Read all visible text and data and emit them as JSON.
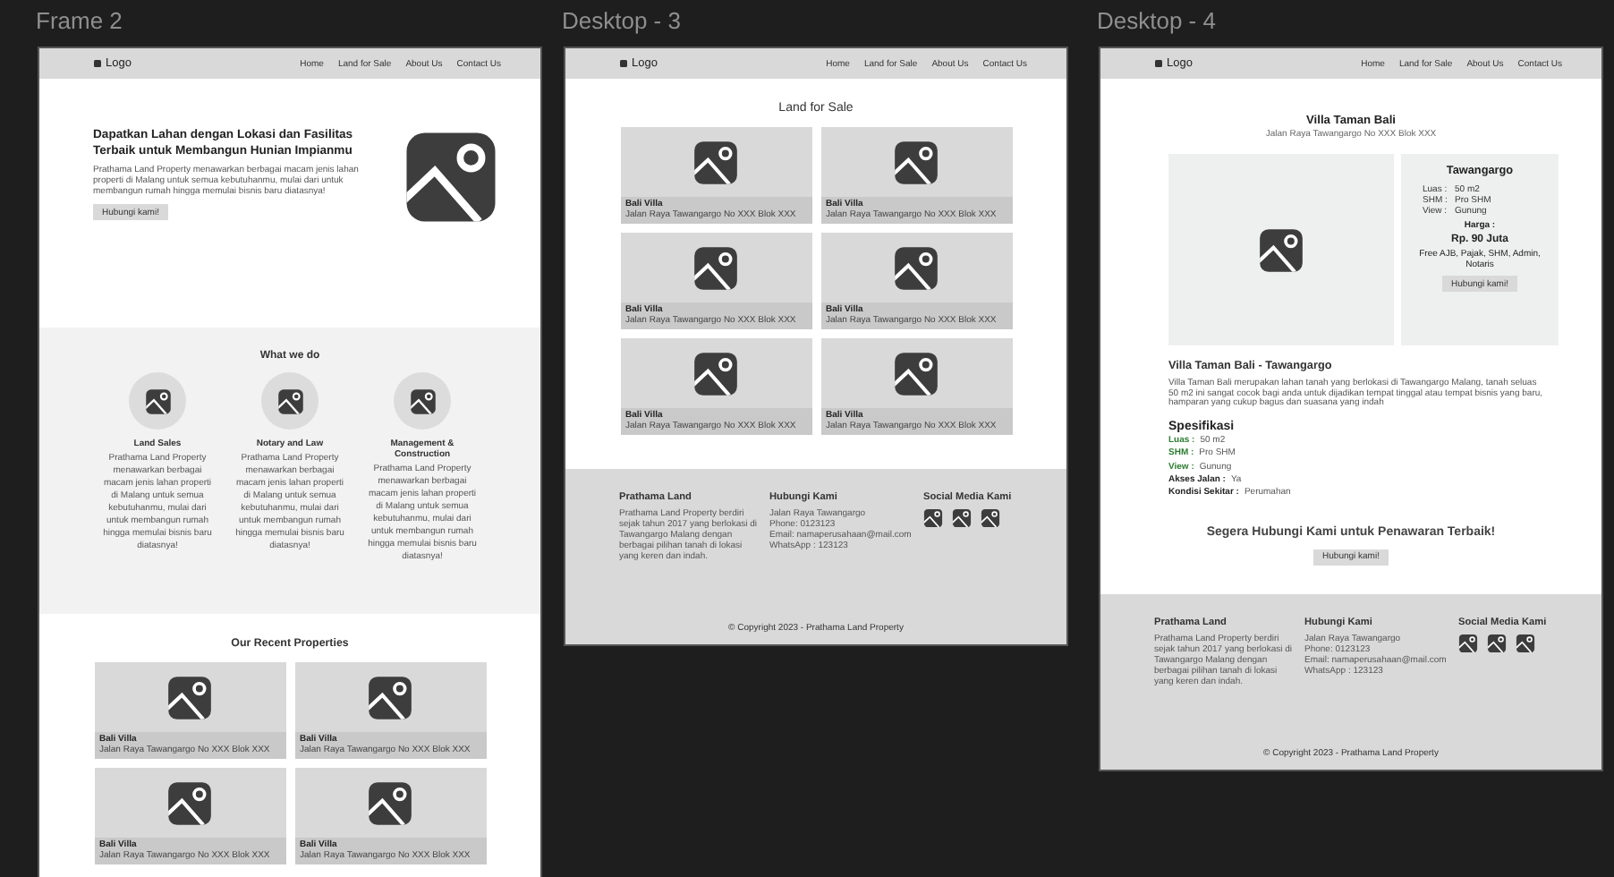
{
  "frames": [
    {
      "kind": "home",
      "title": "Frame 2",
      "nav": {
        "logo": "Logo",
        "links": [
          "Home",
          "Land for Sale",
          "About Us",
          "Contact Us"
        ]
      },
      "hero": {
        "heading": "Dapatkan Lahan dengan Lokasi dan Fasilitas Terbaik untuk Membangun Hunian Impianmu",
        "text": "Prathama Land Property menawarkan berbagai macam jenis lahan properti di Malang untuk semua kebutuhanmu, mulai dari untuk membangun rumah hingga memulai bisnis baru diatasnya!",
        "button": "Hubungi kami!"
      },
      "services": {
        "title": "What we do",
        "items": [
          {
            "title": "Land Sales",
            "text": "Prathama Land Property menawarkan berbagai macam jenis lahan properti di Malang untuk semua kebutuhanmu, mulai dari untuk membangun rumah hingga memulai bisnis baru diatasnya!"
          },
          {
            "title": "Notary and Law",
            "text": "Prathama Land Property menawarkan berbagai macam jenis lahan properti di Malang untuk semua kebutuhanmu, mulai dari untuk membangun rumah hingga memulai bisnis baru diatasnya!"
          },
          {
            "title": "Management & Construction",
            "text": "Prathama Land Property menawarkan berbagai macam jenis lahan properti di Malang untuk semua kebutuhanmu, mulai dari untuk membangun rumah hingga memulai bisnis baru diatasnya!"
          }
        ]
      },
      "recent": {
        "title": "Our Recent Properties",
        "cards": [
          {
            "name": "Bali Villa",
            "address": "Jalan Raya Tawangargo No XXX Blok XXX"
          },
          {
            "name": "Bali Villa",
            "address": "Jalan Raya Tawangargo No XXX Blok XXX"
          },
          {
            "name": "Bali Villa",
            "address": "Jalan Raya Tawangargo No XXX Blok XXX"
          },
          {
            "name": "Bali Villa",
            "address": "Jalan Raya Tawangargo No XXX Blok XXX"
          }
        ]
      }
    },
    {
      "kind": "listing",
      "title": "Desktop - 3",
      "nav": {
        "logo": "Logo",
        "links": [
          "Home",
          "Land for Sale",
          "About Us",
          "Contact Us"
        ]
      },
      "heading": "Land for Sale",
      "cards": [
        {
          "name": "Bali Villa",
          "address": "Jalan Raya Tawangargo No XXX Blok XXX"
        },
        {
          "name": "Bali Villa",
          "address": "Jalan Raya Tawangargo No XXX Blok XXX"
        },
        {
          "name": "Bali Villa",
          "address": "Jalan Raya Tawangargo No XXX Blok XXX"
        },
        {
          "name": "Bali Villa",
          "address": "Jalan Raya Tawangargo No XXX Blok XXX"
        },
        {
          "name": "Bali Villa",
          "address": "Jalan Raya Tawangargo No XXX Blok XXX"
        },
        {
          "name": "Bali Villa",
          "address": "Jalan Raya Tawangargo No XXX Blok XXX"
        }
      ],
      "footer": {
        "about": {
          "title": "Prathama Land",
          "text": "Prathama Land Property berdiri sejak tahun 2017 yang berlokasi di Tawangargo Malang dengan berbagai pilihan tanah di lokasi yang keren dan indah."
        },
        "contact": {
          "title": "Hubungi Kami",
          "lines": [
            "Jalan Raya Tawangargo",
            "Phone: 0123123",
            "Email: namaperusahaan@mail.com",
            "WhatsApp : 123123"
          ]
        },
        "social": {
          "title": "Social Media Kami"
        },
        "copyright": "© Copyright 2023 - Prathama Land Property"
      }
    },
    {
      "kind": "detail",
      "title": "Desktop - 4",
      "nav": {
        "logo": "Logo",
        "links": [
          "Home",
          "Land for Sale",
          "About Us",
          "Contact Us"
        ]
      },
      "heading": "Villa Taman Bali",
      "address": "Jalan Raya Tawangargo No XXX Blok XXX",
      "info": {
        "title": "Tawangargo",
        "specs": [
          {
            "label": "Luas :",
            "value": "50 m2"
          },
          {
            "label": "SHM :",
            "value": "Pro SHM"
          },
          {
            "label": "View :",
            "value": "Gunung"
          }
        ],
        "price_label": "Harga :",
        "price": "Rp. 90 Juta",
        "note": "Free AJB, Pajak, SHM, Admin, Notaris",
        "button": "Hubungi kami!"
      },
      "about": {
        "title": "Villa Taman Bali - Tawangargo",
        "text": "Villa Taman Bali merupakan lahan tanah yang berlokasi di Tawangargo Malang, tanah seluas 50 m2 ini sangat cocok bagi anda untuk dijadikan tempat tinggal atau tempat bisnis yang baru, hamparan yang cukup bagus dan suasana yang indah"
      },
      "specs": {
        "title": "Spesifikasi",
        "items": [
          {
            "label": "Luas :",
            "value": "50 m2",
            "color": "#2e7d32"
          },
          {
            "label": "SHM :",
            "value": "Pro SHM",
            "color": "#2e7d32"
          },
          {
            "label": "View :",
            "value": "Gunung",
            "color": "#2e7d32"
          },
          {
            "label": "Akses Jalan :",
            "value": "Ya",
            "color": "#222222"
          },
          {
            "label": "Kondisi Sekitar :",
            "value": "Perumahan",
            "color": "#222222"
          }
        ]
      },
      "cta": {
        "title": "Segera Hubungi Kami untuk Penawaran Terbaik!",
        "button": "Hubungi kami!"
      },
      "footer": {
        "about": {
          "title": "Prathama Land",
          "text": "Prathama Land Property berdiri sejak tahun 2017 yang berlokasi di Tawangargo Malang dengan berbagai pilihan tanah di lokasi yang keren dan indah."
        },
        "contact": {
          "title": "Hubungi Kami",
          "lines": [
            "Jalan Raya Tawangargo",
            "Phone: 0123123",
            "Email: namaperusahaan@mail.com",
            "WhatsApp : 123123"
          ]
        },
        "social": {
          "title": "Social Media Kami"
        },
        "copyright": "© Copyright 2023 - Prathama Land Property"
      }
    }
  ]
}
